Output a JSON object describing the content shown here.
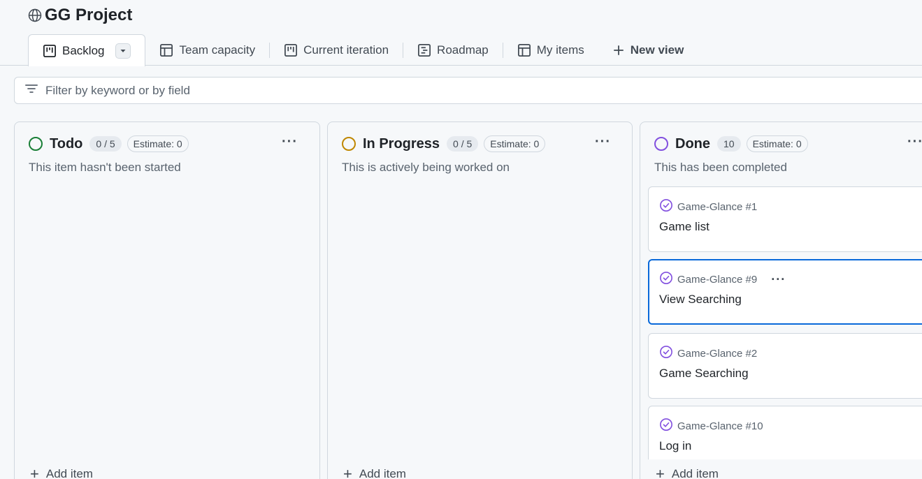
{
  "project": {
    "title": "GG Project",
    "icon": "globe-icon"
  },
  "tabs": [
    {
      "label": "Backlog",
      "icon": "board-icon",
      "active": true
    },
    {
      "label": "Team capacity",
      "icon": "table-icon"
    },
    {
      "label": "Current iteration",
      "icon": "board-icon"
    },
    {
      "label": "Roadmap",
      "icon": "roadmap-icon"
    },
    {
      "label": "My items",
      "icon": "table-icon"
    },
    {
      "label": "New view",
      "icon": "plus-icon"
    }
  ],
  "filter": {
    "placeholder": "Filter by keyword or by field"
  },
  "columns": [
    {
      "name": "Todo",
      "count": "0 / 5",
      "estimate": "Estimate: 0",
      "description": "This item hasn't been started",
      "status_color": "#1a7f37",
      "add_label": "Add item",
      "cards": []
    },
    {
      "name": "In Progress",
      "count": "0 / 5",
      "estimate": "Estimate: 0",
      "description": "This is actively being worked on",
      "status_color": "#bf8700",
      "add_label": "Add item",
      "cards": []
    },
    {
      "name": "Done",
      "count": "10",
      "estimate": "Estimate: 0",
      "description": "This has been completed",
      "status_color": "#8250df",
      "add_label": "Add item",
      "cards": [
        {
          "ref": "Game-Glance #1",
          "title": "Game list"
        },
        {
          "ref": "Game-Glance #9",
          "title": "View Searching",
          "selected": true
        },
        {
          "ref": "Game-Glance #2",
          "title": "Game Searching"
        },
        {
          "ref": "Game-Glance #10",
          "title": "Log in"
        }
      ]
    }
  ],
  "colors": {
    "accent": "#0969da",
    "done_icon": "#8250df",
    "border": "#d0d7de"
  }
}
